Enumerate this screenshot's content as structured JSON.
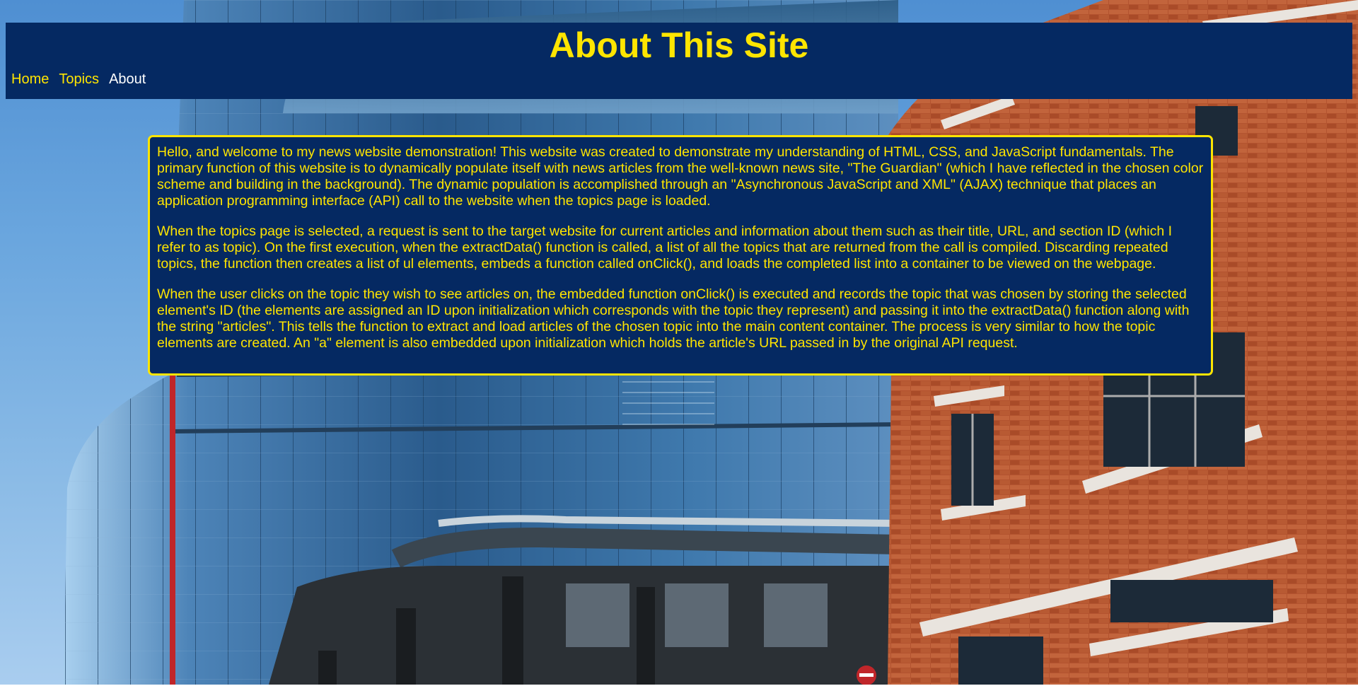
{
  "page": {
    "title": "About This Site"
  },
  "nav": {
    "items": [
      {
        "label": "Home",
        "active": false
      },
      {
        "label": "Topics",
        "active": false
      },
      {
        "label": "About",
        "active": true
      }
    ]
  },
  "content": {
    "paragraphs": [
      "Hello, and welcome to my news website demonstration! This website was created to demonstrate my understanding of HTML, CSS, and JavaScript fundamentals. The primary function of this website is to dynamically populate itself with news articles from the well-known news site, \"The Guardian\" (which I have reflected in the chosen color scheme and building in the background). The dynamic population is accomplished through an \"Asynchronous JavaScript and XML\" (AJAX) technique that places an application programming interface (API) call to the website when the topics page is loaded.",
      "When the topics page is selected, a request is sent to the target website for current articles and information about them such as their title, URL, and section ID (which I refer to as topic). On the first execution, when the extractData() function is called, a list of all the topics that are returned from the call is compiled. Discarding repeated topics, the function then creates a list of ul elements, embeds a function called onClick(), and loads the completed list into a container to be viewed on the webpage.",
      "When the user clicks on the topic they wish to see articles on, the embedded function onClick() is executed and records the topic that was chosen by storing the selected element's ID (the elements are assigned an ID upon initialization which corresponds with the topic they represent) and passing it into the extractData() function along with the string \"articles\". This tells the function to extract and load articles of the chosen topic into the main content container. The process is very similar to how the topic elements are created. An \"a\" element is also embedded upon initialization which holds the article's URL passed in by the original API request."
    ]
  },
  "colors": {
    "brand_navy": "#052962",
    "brand_yellow": "#ffe500",
    "active_nav": "#ffffff"
  }
}
